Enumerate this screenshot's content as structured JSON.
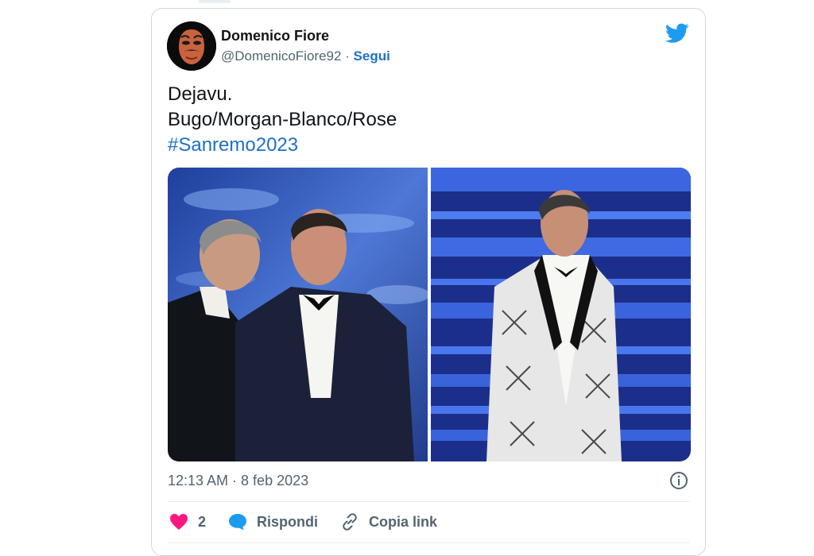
{
  "tweet": {
    "author_name": "Domenico Fiore",
    "author_handle": "@DomenicoFiore92",
    "separator": " · ",
    "follow_label": "Segui",
    "text_lines": [
      "Dejavu.",
      "Bugo/Morgan-Blanco/Rose"
    ],
    "hashtag": "#Sanremo2023",
    "timestamp": "12:13 AM · 8 feb 2023",
    "like_count": "2",
    "reply_label": "Rispondi",
    "copy_link_label": "Copia link"
  },
  "media": [
    {
      "icon": "photo-stage-two-men"
    },
    {
      "icon": "photo-stage-patterned-jacket"
    }
  ],
  "colors": {
    "accent": "#1d70c8",
    "twitter_blue": "#1d9bf0",
    "like_red": "#f91880",
    "muted": "#536471"
  }
}
